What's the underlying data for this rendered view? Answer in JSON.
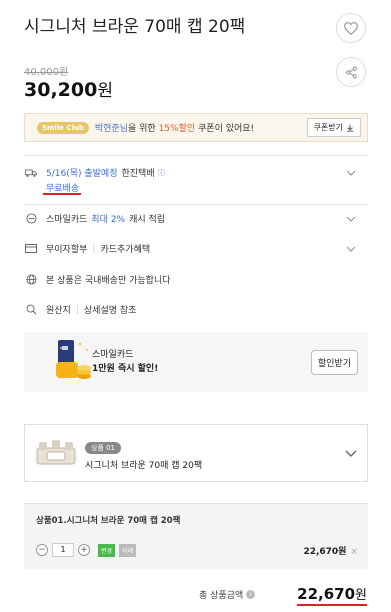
{
  "product": {
    "title": "시그니처 브라운 70매 캡 20팩",
    "original_price": "40,000원",
    "price": "30,200",
    "price_unit": "원"
  },
  "actions": {
    "like_icon": "heart-icon",
    "share_icon": "share-icon"
  },
  "coupon": {
    "badge": "Smile Club",
    "user": "박현준님",
    "text_mid": "을 위한",
    "percent": "15%할인",
    "text_end": "쿠폰이 있어요!",
    "button": "쿠폰받기"
  },
  "shipping": {
    "date": "5/16(목) 출발예정",
    "carrier": "한진택배",
    "free": "무료배송"
  },
  "smile_card": {
    "prefix": "스마일카드",
    "rate": "최대 2%",
    "suffix": "캐시 적립"
  },
  "installment": {
    "a": "무이자할부",
    "b": "카드추가혜택"
  },
  "domestic": "본 상품은 국내배송만 가능합니다",
  "origin": {
    "a": "원산지",
    "b": "상세설명 참조"
  },
  "card_promo": {
    "line1": "스마일카드",
    "line2": "1만원 즉시 할인!",
    "button": "할인받기"
  },
  "selected_product": {
    "badge": "상품 01",
    "name": "시그니처 브라운 70매 캡 20팩"
  },
  "option": {
    "name": "상품01.시그니처 브라운 70매 캡 20팩",
    "quantity": "1",
    "tag_change": "변경",
    "tag_delete": "삭제",
    "price": "22,670원",
    "remove": "×"
  },
  "total": {
    "label": "총 상품금액",
    "price": "22,670",
    "unit": "원"
  },
  "colors": {
    "accent_blue": "#3b6fd6",
    "accent_red": "#e02020",
    "discount_orange": "#e45a2a"
  }
}
